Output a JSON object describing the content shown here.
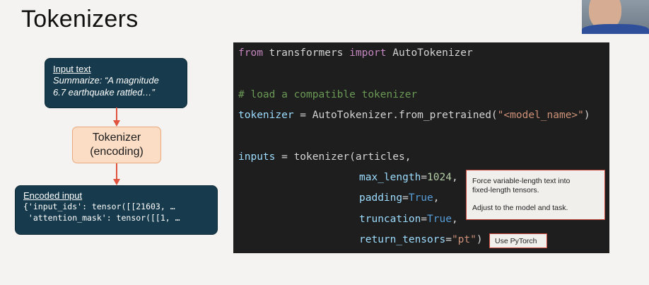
{
  "slide": {
    "title": "Tokenizers"
  },
  "diagram": {
    "input_box": {
      "label": "Input text",
      "text": "Summarize: “A magnitude\n6.7 earthquake rattled…”"
    },
    "tokenizer_box": {
      "line1": "Tokenizer",
      "line2": "(encoding)"
    },
    "encoded_box": {
      "label": "Encoded input",
      "line1": "{'input_ids': tensor([[21603, …",
      "line2": " 'attention_mask': tensor([[1, …"
    },
    "arrow_color": "#e0533f"
  },
  "code": {
    "lines": [
      {
        "segments": [
          {
            "t": "from",
            "c": "kw"
          },
          {
            "t": " transformers ",
            "c": ""
          },
          {
            "t": "import",
            "c": "kw"
          },
          {
            "t": " AutoTokenizer",
            "c": ""
          }
        ]
      },
      {
        "segments": [
          {
            "t": "# load a compatible tokenizer",
            "c": "cm"
          }
        ]
      },
      {
        "segments": [
          {
            "t": "tokenizer",
            "c": "var"
          },
          {
            "t": " = AutoTokenizer.from_pretrained(",
            "c": ""
          },
          {
            "t": "\"<model_name>\"",
            "c": "str"
          },
          {
            "t": ")",
            "c": ""
          }
        ]
      },
      {
        "segments": [
          {
            "t": "inputs",
            "c": "var"
          },
          {
            "t": " = tokenizer(articles,",
            "c": ""
          }
        ]
      },
      {
        "segments": [
          {
            "t": "max_length",
            "c": "var"
          },
          {
            "t": "=",
            "c": ""
          },
          {
            "t": "1024",
            "c": "num"
          },
          {
            "t": ",",
            "c": ""
          }
        ]
      },
      {
        "segments": [
          {
            "t": "padding",
            "c": "var"
          },
          {
            "t": "=",
            "c": ""
          },
          {
            "t": "True",
            "c": "kwc"
          },
          {
            "t": ",",
            "c": ""
          }
        ]
      },
      {
        "segments": [
          {
            "t": "truncation",
            "c": "var"
          },
          {
            "t": "=",
            "c": ""
          },
          {
            "t": "True",
            "c": "kwc"
          },
          {
            "t": ",",
            "c": ""
          }
        ]
      },
      {
        "segments": [
          {
            "t": "return_tensors",
            "c": "var"
          },
          {
            "t": "=",
            "c": ""
          },
          {
            "t": "\"pt\"",
            "c": "str"
          },
          {
            "t": ")",
            "c": ""
          }
        ]
      }
    ]
  },
  "callouts": {
    "a_line1": "Force variable-length text into",
    "a_line2": "fixed-length tensors.",
    "a_line3": "Adjust to the model and task.",
    "b": "Use PyTorch"
  }
}
